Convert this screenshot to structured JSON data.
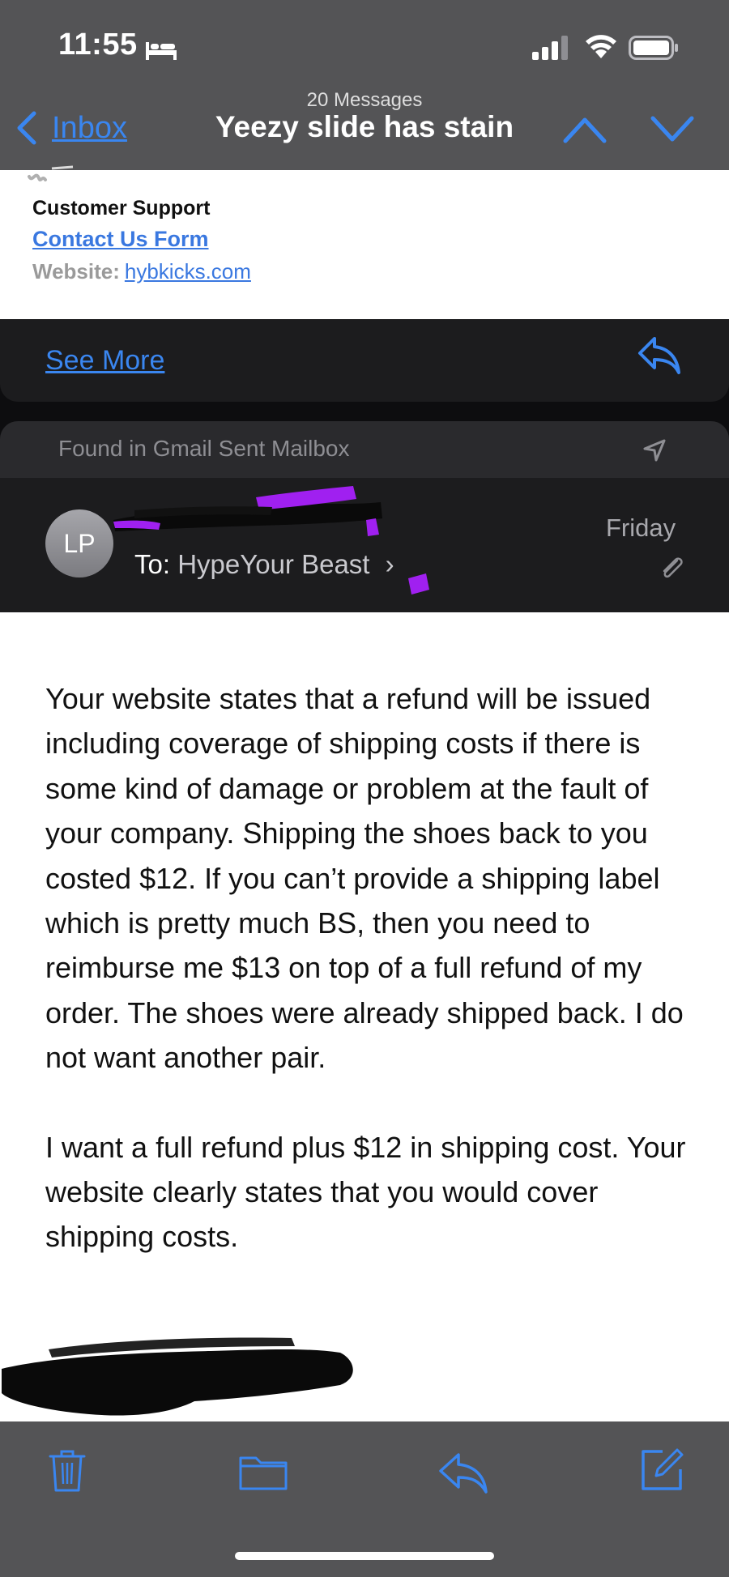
{
  "status_bar": {
    "time": "11:55"
  },
  "nav": {
    "message_count": "20 Messages",
    "back_label": "Inbox",
    "subject": "Yeezy slide has stain"
  },
  "previous_message": {
    "signature_name": "Customer Support",
    "contact_link": "Contact Us Form",
    "website_label": "Website:",
    "website_link": "hybkicks.com",
    "see_more": "See More"
  },
  "current_message": {
    "found_in": "Found in Gmail Sent Mailbox",
    "avatar_initials": "LP",
    "to_prefix": "To:",
    "to_name": "HypeYour Beast",
    "date": "Friday",
    "body_paragraphs": [
      "Your website states that a refund will be issued including coverage of shipping costs if there is some kind of damage or problem at the fault of your company. Shipping the shoes back to you costed $12.  If you can’t provide a shipping label which is pretty much BS, then you need to reimburse me $13 on top of a full refund of my order.  The shoes were already shipped back. I do not want another pair.",
      "I want a full refund plus $12 in shipping cost.  Your website clearly states that you would cover shipping costs."
    ]
  },
  "colors": {
    "accent": "#3a86f0",
    "bar_gray": "#545456",
    "dark_bg": "#1c1c1e",
    "redaction_purple": "#a020f0"
  },
  "icons": {
    "toolbar": [
      "trash-icon",
      "folder-icon",
      "reply-icon",
      "compose-icon"
    ]
  }
}
